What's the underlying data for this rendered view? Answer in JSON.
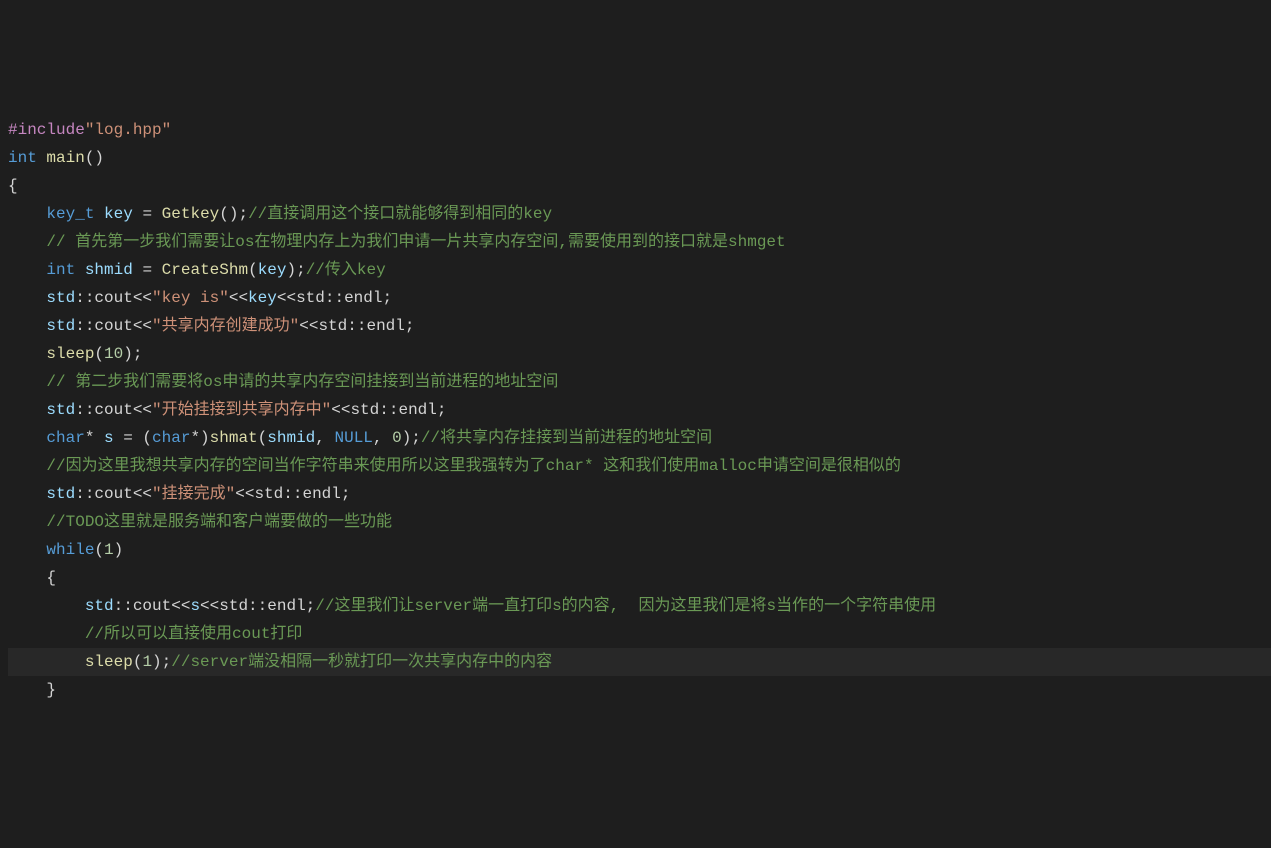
{
  "code": {
    "l1_include": "#include",
    "l1_str": "\"log.hpp\"",
    "l2_int": "int",
    "l2_main": "main",
    "l2_paren": "()",
    "l3_brace": "{",
    "l4_type": "key_t",
    "l4_var": "key",
    "l4_eq": " = ",
    "l4_func": "Getkey",
    "l4_after": "();",
    "l4_comment": "//直接调用这个接口就能够得到相同的key",
    "l5_comment": "// 首先第一步我们需要让os在物理内存上为我们申请一片共享内存空间,需要使用到的接口就是shmget",
    "l6_int": "int",
    "l6_var": "shmid",
    "l6_eq": " = ",
    "l6_func": "CreateShm",
    "l6_open": "(",
    "l6_arg": "key",
    "l6_close": ");",
    "l6_comment": "//传入key",
    "l7_std": "std",
    "l7_cout": "::cout<<",
    "l7_str": "\"key is\"",
    "l7_mid": "<<",
    "l7_key": "key",
    "l7_end": "<<std::endl;",
    "l8_std": "std",
    "l8_cout": "::cout<<",
    "l8_str": "\"共享内存创建成功\"",
    "l8_end": "<<std::endl;",
    "l9_sleep": "sleep",
    "l9_open": "(",
    "l9_num": "10",
    "l9_close": ");",
    "l10_comment": "// 第二步我们需要将os申请的共享内存空间挂接到当前进程的地址空间",
    "l11_std": "std",
    "l11_cout": "::cout<<",
    "l11_str": "\"开始挂接到共享内存中\"",
    "l11_end": "<<std::endl;",
    "l12_char": "char",
    "l12_star": "* ",
    "l12_var": "s",
    "l12_eq": " = (",
    "l12_char2": "char",
    "l12_star2": "*)",
    "l12_func": "shmat",
    "l12_open": "(",
    "l12_arg1": "shmid",
    "l12_comma1": ", ",
    "l12_null": "NULL",
    "l12_comma2": ", ",
    "l12_zero": "0",
    "l12_close": ");",
    "l12_comment": "//将共享内存挂接到当前进程的地址空间",
    "l13_comment": "//因为这里我想共享内存的空间当作字符串来使用所以这里我强转为了char* 这和我们使用malloc申请空间是很相似的",
    "l14_std": "std",
    "l14_cout": "::cout<<",
    "l14_str": "\"挂接完成\"",
    "l14_end": "<<std::endl;",
    "l15_comment": "//TODO这里就是服务端和客户端要做的一些功能",
    "l16_while": "while",
    "l16_open": "(",
    "l16_num": "1",
    "l16_close": ")",
    "l17_brace": "{",
    "l18_std": "std",
    "l18_cout": "::cout<<",
    "l18_s": "s",
    "l18_end": "<<std::endl;",
    "l18_comment": "//这里我们让server端一直打印s的内容,  因为这里我们是将s当作的一个字符串使用",
    "l19_comment": "//所以可以直接使用cout打印",
    "l20_sleep": "sleep",
    "l20_open": "(",
    "l20_num": "1",
    "l20_close": ");",
    "l20_comment": "//server端没相隔一秒就打印一次共享内存中的内容",
    "l21_brace": "}"
  }
}
